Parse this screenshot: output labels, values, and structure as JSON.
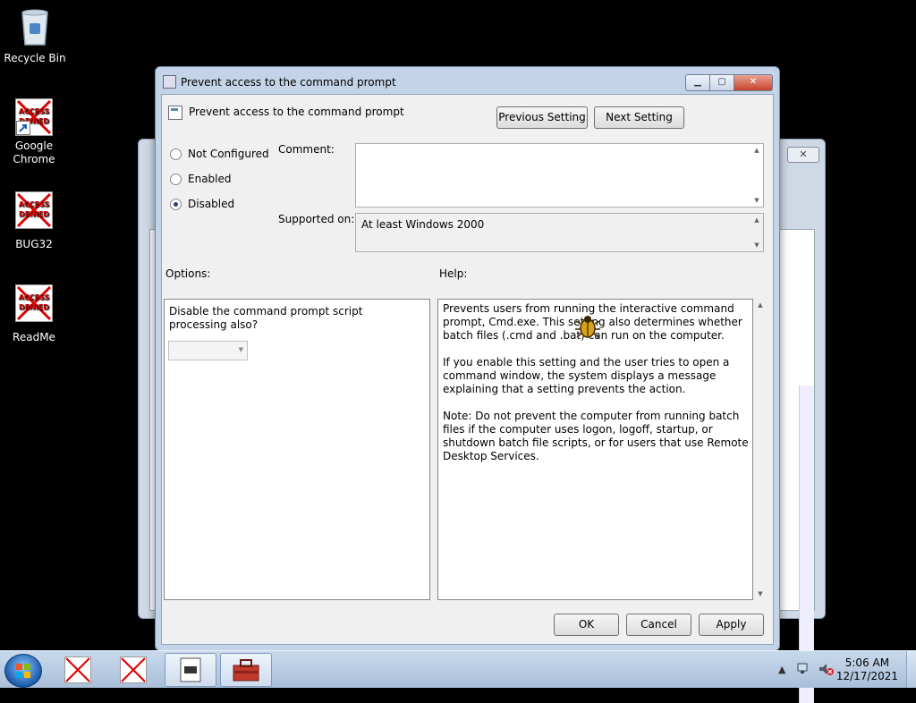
{
  "desktop": {
    "icons": [
      {
        "label": "Recycle Bin"
      },
      {
        "label": "Google\nChrome",
        "line1": "Google",
        "line2": "Chrome"
      },
      {
        "label": "BUG32"
      },
      {
        "label": "ReadMe"
      }
    ],
    "denied_text_1": "ACCESS",
    "denied_text_2": "DENIED"
  },
  "dialog": {
    "title": "Prevent access to the command prompt",
    "header_text": "Prevent access to the command prompt",
    "prev_button": "Previous Setting",
    "next_button": "Next Setting",
    "radios": [
      {
        "label": "Not Configured",
        "checked": false
      },
      {
        "label": "Enabled",
        "checked": false
      },
      {
        "label": "Disabled",
        "checked": true
      }
    ],
    "comment_label": "Comment:",
    "comment_value": "",
    "supported_label": "Supported on:",
    "supported_value": "At least Windows 2000",
    "options_label": "Options:",
    "help_label": "Help:",
    "option_text": "Disable the command prompt script processing also?",
    "option_select_value": "",
    "help_paragraphs": [
      "Prevents users from running the interactive command prompt, Cmd.exe. This setting also determines whether batch files (.cmd and .bat) can run on the computer.",
      "If you enable this setting and the user tries to open a command window, the system displays a message explaining that a setting prevents the action.",
      "Note: Do not prevent the computer from running batch files if the computer uses logon, logoff, startup, or shutdown batch file scripts, or for users that use Remote Desktop Services."
    ],
    "ok_button": "OK",
    "cancel_button": "Cancel",
    "apply_button": "Apply"
  },
  "taskbar": {
    "time": "5:06 AM",
    "date": "12/17/2021"
  },
  "colors": {
    "desktop": "#000000",
    "dialog_frame": "#c3d4e8",
    "taskbar": "#b9cde4",
    "close_button": "#c8432b"
  }
}
